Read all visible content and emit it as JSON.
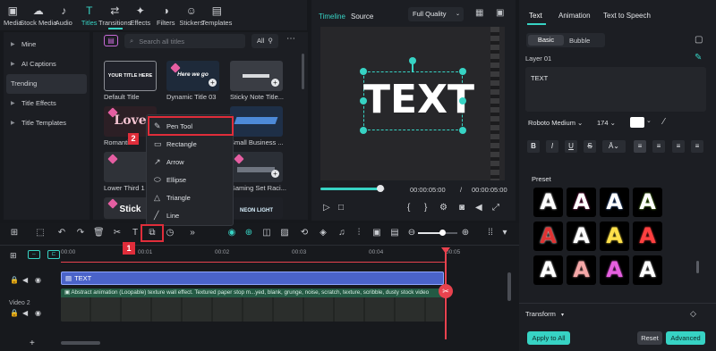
{
  "topbar": {
    "items": [
      {
        "label": "Media",
        "icon": "media-icon",
        "glyph": "▣"
      },
      {
        "label": "Stock Media",
        "icon": "cloud-icon",
        "glyph": "☁"
      },
      {
        "label": "Audio",
        "icon": "music-icon",
        "glyph": "♪"
      },
      {
        "label": "Titles",
        "icon": "titles-icon",
        "glyph": "T"
      },
      {
        "label": "Transitions",
        "icon": "transitions-icon",
        "glyph": "⇄"
      },
      {
        "label": "Effects",
        "icon": "effects-icon",
        "glyph": "✦"
      },
      {
        "label": "Filters",
        "icon": "filters-icon",
        "glyph": "◑"
      },
      {
        "label": "Stickers",
        "icon": "stickers-icon",
        "glyph": "☺"
      },
      {
        "label": "Templates",
        "icon": "templates-icon",
        "glyph": "▤"
      }
    ]
  },
  "leftnav": {
    "items": [
      "Mine",
      "AI Captions",
      "Trending",
      "Title Effects",
      "Title Templates"
    ]
  },
  "assets": {
    "search_placeholder": "Search all titles",
    "filter_label": "All",
    "titles": [
      "Default Title",
      "Dynamic Title 03",
      "Sticky Note Title...",
      "Romantic...",
      "Small Business ...",
      "Lower Third 1",
      "Gaming Set Raci..."
    ],
    "thumb_text": [
      "YOUR TITLE HERE",
      "Here we go",
      "",
      "Love",
      "",
      "",
      "",
      "Stick",
      "NEON LIGHT"
    ]
  },
  "menu": {
    "items": [
      {
        "label": "Pen Tool",
        "icon": "pen-tool-icon",
        "glyph": "✎"
      },
      {
        "label": "Rectangle",
        "icon": "rectangle-icon",
        "glyph": "▭"
      },
      {
        "label": "Arrow",
        "icon": "arrow-icon",
        "glyph": "↗"
      },
      {
        "label": "Ellipse",
        "icon": "ellipse-icon",
        "glyph": "⬭"
      },
      {
        "label": "Triangle",
        "icon": "triangle-icon",
        "glyph": "△"
      },
      {
        "label": "Line",
        "icon": "line-icon",
        "glyph": "╱"
      }
    ]
  },
  "badges": {
    "one": "1",
    "two": "2"
  },
  "preview": {
    "tab_timeline": "Timeline",
    "tab_source": "Source",
    "quality": "Full Quality",
    "canvas_text": "TEXT",
    "current_time": "00:00:05:00",
    "separator": "/",
    "total_time": "00:00:05:00",
    "progress": 0.97
  },
  "rightpanel": {
    "tabs": [
      "Text",
      "Animation",
      "Text to Speech"
    ],
    "sub_tabs": [
      "Basic",
      "Bubble"
    ],
    "layer_label": "Layer 01",
    "text_value": "TEXT",
    "font": "Roboto Medium",
    "font_size": "174",
    "style_buttons": [
      "B",
      "I",
      "U",
      "S"
    ],
    "preset_label": "Preset",
    "transform_label": "Transform",
    "apply_all": "Apply to All",
    "reset": "Reset",
    "advanced": "Advanced"
  },
  "timeline": {
    "ruler": [
      "00:00",
      "00:01",
      "00:02",
      "00:03",
      "00:04",
      "00:05"
    ],
    "title_clip": "TEXT",
    "video_clip": "Abstract animation (Loopable) texture wall effect. Textured paper stop m...yed, blank, grunge, noise, scratch, texture, scribble, dusty stock video",
    "track_label": "Video 2"
  },
  "colors": {
    "accent": "#37d3c4",
    "highlight": "#e02d3a",
    "title_clip": "#4a63c9",
    "playhead": "#e8424e"
  }
}
